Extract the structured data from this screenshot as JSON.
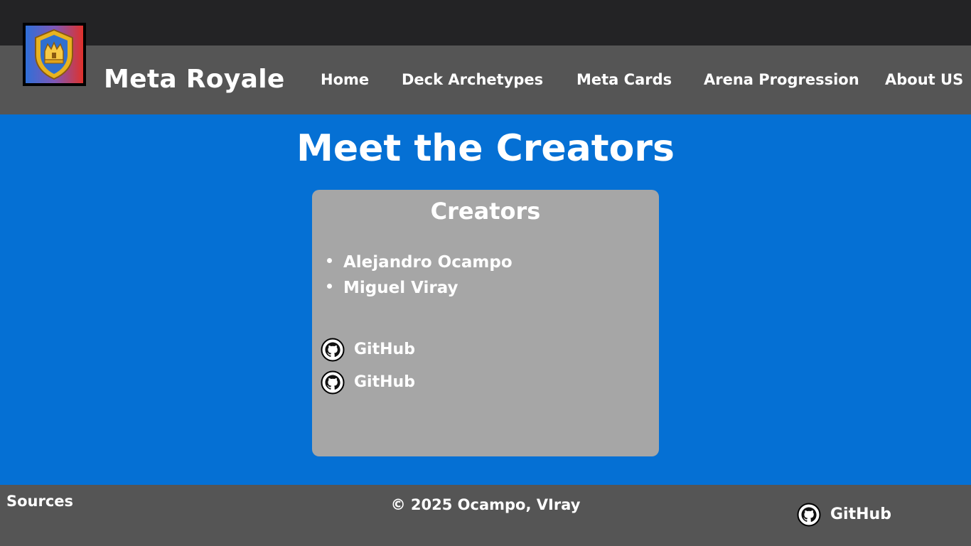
{
  "site": {
    "title": "Meta Royale",
    "logo_icon": "clash-royale-crown-shield-icon"
  },
  "nav": {
    "items": [
      {
        "label": "Home"
      },
      {
        "label": "Deck Archetypes"
      },
      {
        "label": "Meta Cards"
      },
      {
        "label": "Arena Progression"
      },
      {
        "label": "About US"
      }
    ]
  },
  "main": {
    "page_title": "Meet the Creators",
    "card": {
      "title": "Creators",
      "creators": [
        "Alejandro Ocampo",
        "Miguel Viray"
      ],
      "links": [
        {
          "label": "GitHub",
          "icon": "github-icon"
        },
        {
          "label": "GitHub",
          "icon": "github-icon"
        }
      ]
    }
  },
  "footer": {
    "sources_label": "Sources",
    "copyright": "© 2025 Ocampo, VIray",
    "github_label": "GitHub",
    "github_icon": "github-icon"
  },
  "colors": {
    "topbar": "#232325",
    "header": "#555555",
    "main_background": "#0570d4",
    "card_background": "#a6a6a6",
    "footer": "#555555",
    "text": "#ffffff"
  }
}
